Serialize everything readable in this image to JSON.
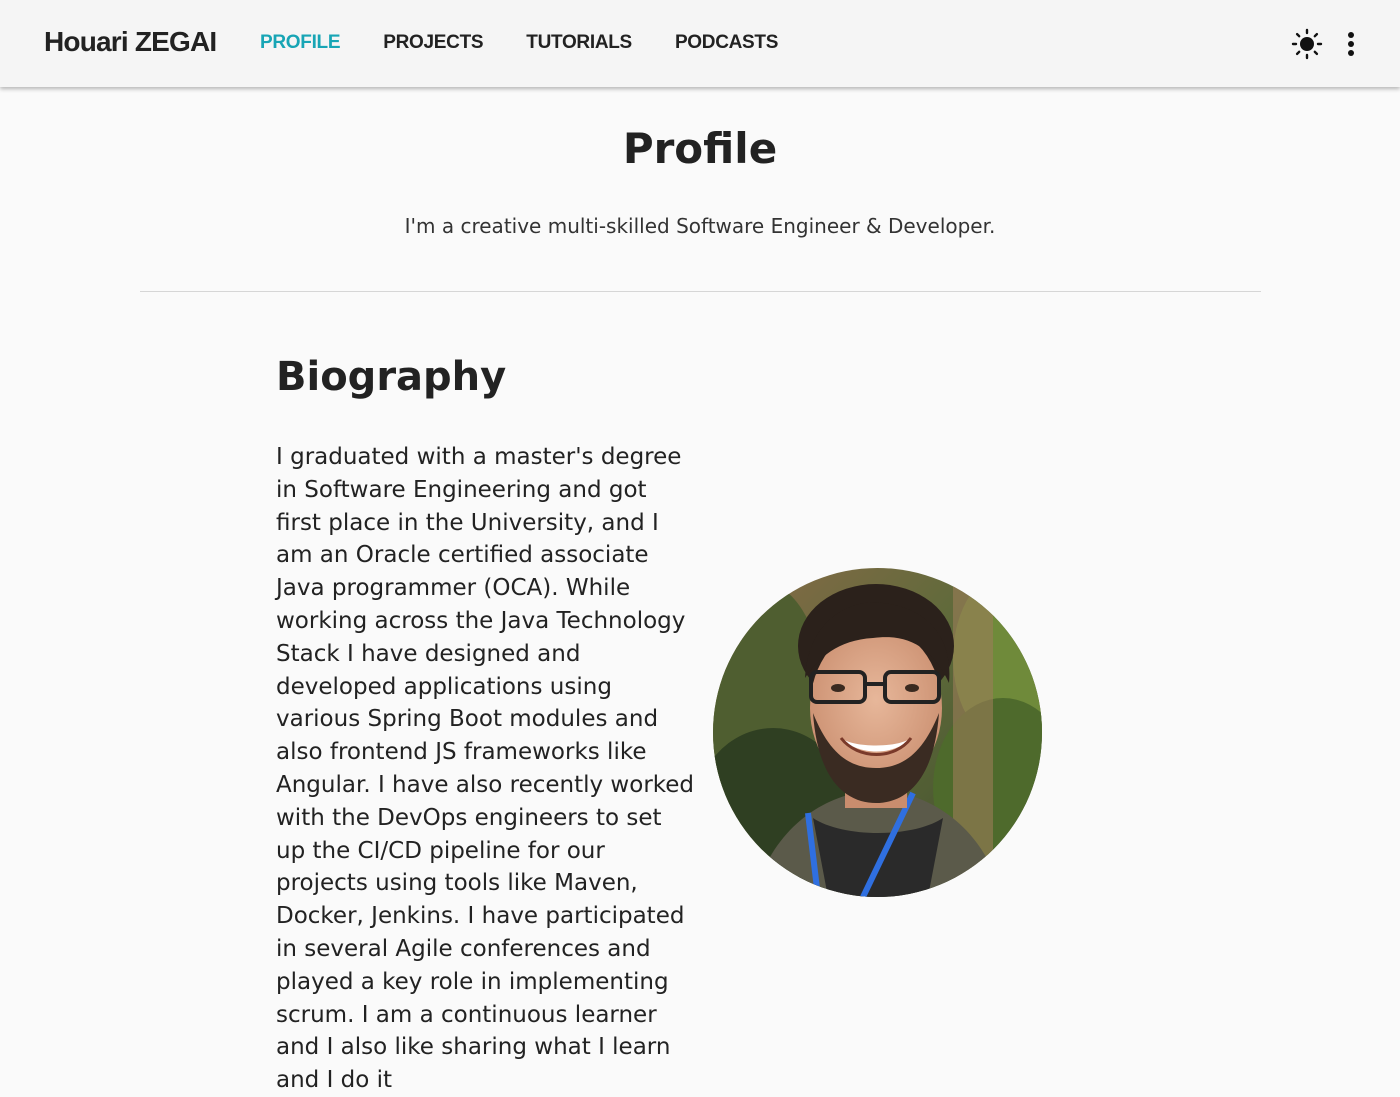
{
  "header": {
    "brand": "Houari ZEGAI",
    "nav": [
      {
        "label": "PROFILE",
        "active": true
      },
      {
        "label": "PROJECTS",
        "active": false
      },
      {
        "label": "TUTORIALS",
        "active": false
      },
      {
        "label": "PODCASTS",
        "active": false
      }
    ],
    "icons": {
      "theme_toggle": "sun-icon",
      "menu": "more-vertical-icon"
    },
    "accent_color": "#18a5b5"
  },
  "main": {
    "title": "Profile",
    "subtitle": "I'm a creative multi-skilled Software Engineer & Developer.",
    "biography": {
      "heading": "Biography",
      "text": "I graduated with a master's degree in Software Engineering and got first place in the University, and I am an Oracle certified associate Java programmer (OCA). While working across the Java Technology Stack I have designed and developed applications using various Spring Boot modules and also frontend JS frameworks like Angular. I have also recently worked with the DevOps engineers to set up the CI/CD pipeline for our projects using tools like Maven, Docker, Jenkins. I have participated in several Agile conferences and played a key role in implementing scrum. I am a continuous learner and I also like sharing what I learn and I do it"
    }
  }
}
